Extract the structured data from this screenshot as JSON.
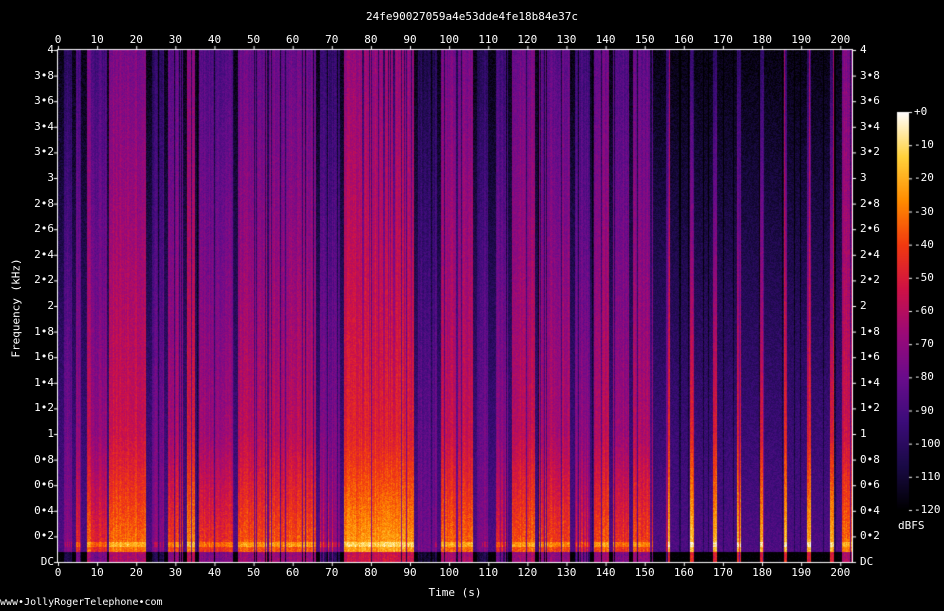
{
  "title": "24fe90027059a4e53dde4fe18b84e37c",
  "credit": "www•JollyRogerTelephone•com",
  "chart_data": {
    "type": "heatmap",
    "subtype": "spectrogram",
    "xlabel": "Time (s)",
    "ylabel": "Frequency (kHz)",
    "xlim": [
      0,
      203
    ],
    "ylim": [
      0,
      4
    ],
    "x_ticks": [
      "0",
      "10",
      "20",
      "30",
      "40",
      "50",
      "60",
      "70",
      "80",
      "90",
      "100",
      "110",
      "120",
      "130",
      "140",
      "150",
      "160",
      "170",
      "180",
      "190",
      "200"
    ],
    "x_tick_values": [
      0,
      10,
      20,
      30,
      40,
      50,
      60,
      70,
      80,
      90,
      100,
      110,
      120,
      130,
      140,
      150,
      160,
      170,
      180,
      190,
      200
    ],
    "y_ticks": [
      "DC",
      "0•2",
      "0•4",
      "0•6",
      "0•8",
      "1",
      "1•2",
      "1•4",
      "1•6",
      "1•8",
      "2",
      "2•2",
      "2•4",
      "2•6",
      "2•8",
      "3",
      "3•2",
      "3•4",
      "3•6",
      "3•8",
      "4"
    ],
    "y_tick_values": [
      0,
      0.2,
      0.4,
      0.6,
      0.8,
      1,
      1.2,
      1.4,
      1.6,
      1.8,
      2,
      2.2,
      2.4,
      2.6,
      2.8,
      3,
      3.2,
      3.4,
      3.6,
      3.8,
      4
    ],
    "colorbar": {
      "unit": "dBFS",
      "range": [
        -120,
        0
      ],
      "ticks": [
        "+0",
        "-10",
        "-20",
        "-30",
        "-40",
        "-50",
        "-60",
        "-70",
        "-80",
        "-90",
        "-100",
        "-110",
        "-120"
      ],
      "tick_values": [
        0,
        -10,
        -20,
        -30,
        -40,
        -50,
        -60,
        -70,
        -80,
        -90,
        -100,
        -110,
        -120
      ],
      "colormap": [
        "#000000",
        "#1a0a46",
        "#3c0c7a",
        "#6a0c8c",
        "#9c0a78",
        "#cf1246",
        "#f23a10",
        "#ff8c00",
        "#ffd23c",
        "#ffffff"
      ]
    },
    "bursts": [
      {
        "start": 1.5,
        "end": 3.5,
        "level": 0.42
      },
      {
        "start": 4.5,
        "end": 6,
        "level": 0.48
      },
      {
        "start": 7.5,
        "end": 8.5,
        "level": 0.62
      },
      {
        "start": 8.5,
        "end": 12.5,
        "level": 0.5
      },
      {
        "start": 13,
        "end": 22.5,
        "level": 0.62
      },
      {
        "start": 24,
        "end": 27,
        "level": 0.42
      },
      {
        "start": 28,
        "end": 32,
        "level": 0.55
      },
      {
        "start": 33,
        "end": 35,
        "level": 0.66
      },
      {
        "start": 36,
        "end": 45,
        "level": 0.52
      },
      {
        "start": 46,
        "end": 66,
        "level": 0.58
      },
      {
        "start": 67,
        "end": 72,
        "level": 0.44
      },
      {
        "start": 73,
        "end": 91,
        "level": 0.68
      },
      {
        "start": 92,
        "end": 97,
        "level": 0.38
      },
      {
        "start": 98,
        "end": 106,
        "level": 0.6
      },
      {
        "start": 107,
        "end": 110,
        "level": 0.4
      },
      {
        "start": 112,
        "end": 115,
        "level": 0.46
      },
      {
        "start": 116,
        "end": 122,
        "level": 0.6
      },
      {
        "start": 123,
        "end": 131,
        "level": 0.55
      },
      {
        "start": 132,
        "end": 136,
        "level": 0.48
      },
      {
        "start": 137,
        "end": 141,
        "level": 0.58
      },
      {
        "start": 142,
        "end": 146,
        "level": 0.52
      },
      {
        "start": 147,
        "end": 152,
        "level": 0.56
      },
      {
        "start": 155.5,
        "end": 156.5,
        "level": 0.74
      },
      {
        "start": 161.5,
        "end": 162.5,
        "level": 0.74
      },
      {
        "start": 167.5,
        "end": 168.5,
        "level": 0.74
      },
      {
        "start": 173.5,
        "end": 174.5,
        "level": 0.74
      },
      {
        "start": 179.5,
        "end": 180.5,
        "level": 0.74
      },
      {
        "start": 185.5,
        "end": 186.5,
        "level": 0.74
      },
      {
        "start": 191.5,
        "end": 192.5,
        "level": 0.74
      },
      {
        "start": 197.5,
        "end": 198.5,
        "level": 0.72
      },
      {
        "start": 200.5,
        "end": 203,
        "level": 0.62
      }
    ]
  }
}
